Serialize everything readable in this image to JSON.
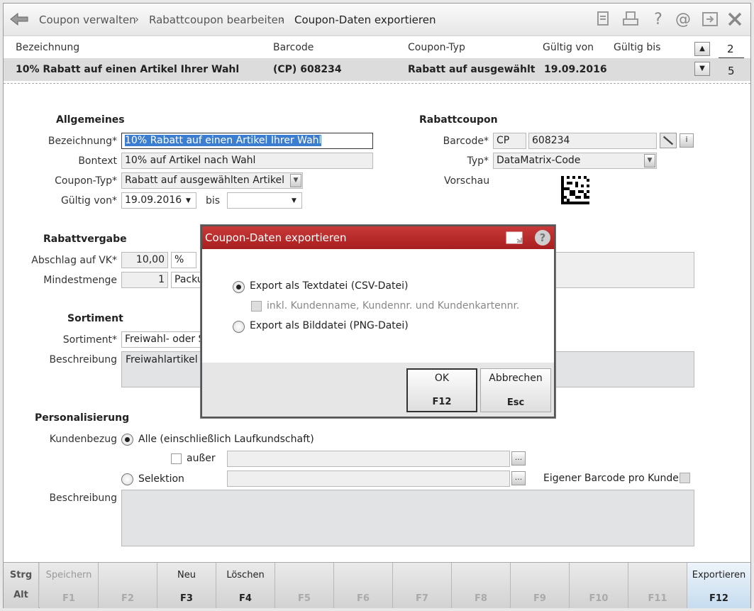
{
  "breadcrumb": [
    "Coupon verwalten",
    "Rabattcoupon bearbeiten",
    "Coupon-Daten exportieren"
  ],
  "toolbar_icons": [
    "document-icon",
    "print-icon",
    "help-icon",
    "email-icon",
    "window-icon",
    "close-icon"
  ],
  "list": {
    "headers": [
      "Bezeichnung",
      "Barcode",
      "Coupon-Typ",
      "Gültig von",
      "Gültig bis"
    ],
    "row": [
      "10% Rabatt auf einen Artikel Ihrer Wahl",
      "(CP) 608234",
      "Rabatt auf ausgewählten A",
      "19.09.2016",
      ""
    ],
    "page_current": "2",
    "page_total": "5"
  },
  "allgemeines": {
    "title": "Allgemeines",
    "bezeichnung_label": "Bezeichnung*",
    "bezeichnung_value": "10% Rabatt auf einen Artikel Ihrer Wahl",
    "bontext_label": "Bontext",
    "bontext_value": "10% auf Artikel nach Wahl",
    "typ_label": "Coupon-Typ*",
    "typ_value": "Rabatt auf ausgewählten Artikel",
    "gueltig_label": "Gültig von*",
    "gueltig_von": "19.09.2016",
    "bis_label": "bis",
    "gueltig_bis": ""
  },
  "rabattcoupon": {
    "title": "Rabattcoupon",
    "barcode_label": "Barcode*",
    "barcode_prefix": "CP",
    "barcode_value": "608234",
    "typ_label": "Typ*",
    "typ_value": "DataMatrix-Code",
    "vorschau_label": "Vorschau"
  },
  "rabattvergabe": {
    "title": "Rabattvergabe",
    "abschlag_label": "Abschlag auf VK*",
    "abschlag_value": "10,00",
    "abschlag_unit": "%",
    "mindestmenge_label": "Mindestmenge",
    "mindestmenge_value": "1",
    "mindestmenge_unit": "Packu"
  },
  "sortiment": {
    "title": "Sortiment",
    "sortiment_label": "Sortiment*",
    "sortiment_value": "Freiwahl- oder S",
    "beschreibung_label": "Beschreibung",
    "beschreibung_value": "Freiwahlartikel o"
  },
  "personalisierung": {
    "title": "Personalisierung",
    "kundenbezug_label": "Kundenbezug",
    "alle_label": "Alle (einschließlich Laufkundschaft)",
    "ausser_label": "außer",
    "selektion_label": "Selektion",
    "eigener_barcode_label": "Eigener Barcode pro Kunde",
    "beschreibung_label": "Beschreibung",
    "ellipsis": "..."
  },
  "dialog": {
    "title": "Coupon-Daten exportieren",
    "option_csv": "Export als Textdatei (CSV-Datei)",
    "option_csv_sub": "inkl. Kundenname, Kundennr. und Kundenkartennr.",
    "option_png": "Export als Bilddatei (PNG-Datei)",
    "ok_label": "OK",
    "ok_key": "F12",
    "cancel_label": "Abbrechen",
    "cancel_key": "Esc",
    "help": "?"
  },
  "fkeys": {
    "strg": "Strg",
    "alt": "Alt",
    "keys": [
      {
        "label": "Speichern",
        "key": "F1"
      },
      {
        "label": "",
        "key": "F2"
      },
      {
        "label": "Neu",
        "key": "F3"
      },
      {
        "label": "Löschen",
        "key": "F4"
      },
      {
        "label": "",
        "key": "F5"
      },
      {
        "label": "",
        "key": "F6"
      },
      {
        "label": "",
        "key": "F7"
      },
      {
        "label": "",
        "key": "F8"
      },
      {
        "label": "",
        "key": "F9"
      },
      {
        "label": "",
        "key": "F10"
      },
      {
        "label": "",
        "key": "F11"
      },
      {
        "label": "Exportieren",
        "key": "F12"
      }
    ]
  }
}
